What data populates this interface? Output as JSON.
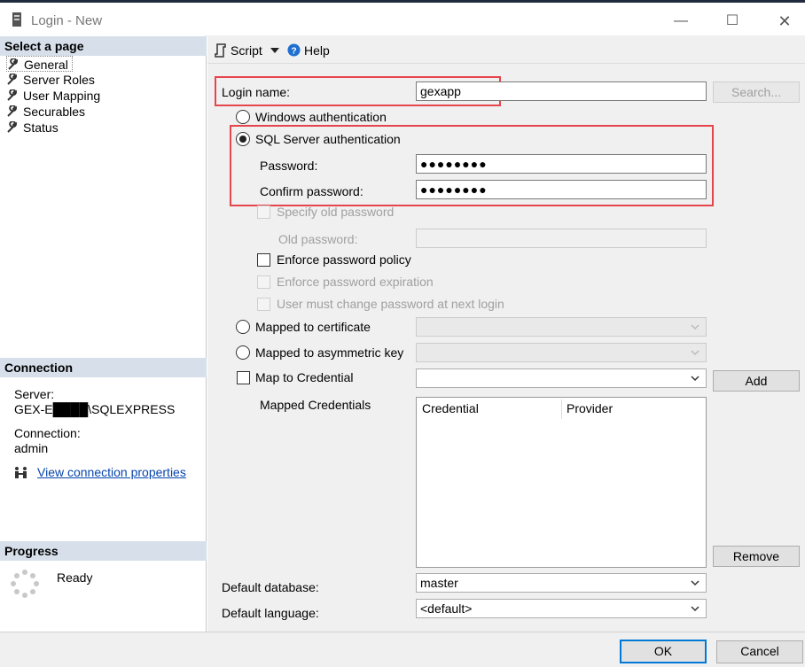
{
  "window": {
    "title": "Login - New"
  },
  "left": {
    "select_header": "Select a page",
    "pages": [
      "General",
      "Server Roles",
      "User Mapping",
      "Securables",
      "Status"
    ],
    "connection_header": "Connection",
    "server_label": "Server:",
    "server_value": "GEX-E████\\SQLEXPRESS",
    "connection_label": "Connection:",
    "connection_value": "admin",
    "view_props_link": "View connection properties",
    "progress_header": "Progress",
    "progress_status": "Ready"
  },
  "toolbar": {
    "script_label": "Script",
    "help_label": "Help"
  },
  "form": {
    "login_name_label": "Login name:",
    "login_name_value": "gexapp",
    "search_button": "Search...",
    "windows_auth": "Windows authentication",
    "sql_auth": "SQL Server authentication",
    "password_label": "Password:",
    "password_value": "●●●●●●●●",
    "confirm_label": "Confirm password:",
    "confirm_value": "●●●●●●●●",
    "specify_old": "Specify old password",
    "old_password_label": "Old password:",
    "enforce_policy": "Enforce password policy",
    "enforce_expiration": "Enforce password expiration",
    "must_change": "User must change password at next login",
    "mapped_cert": "Mapped to certificate",
    "mapped_asym": "Mapped to asymmetric key",
    "map_credential": "Map to Credential",
    "add_button": "Add",
    "mapped_credentials_label": "Mapped Credentials",
    "grid_columns": [
      "Credential",
      "Provider"
    ],
    "remove_button": "Remove",
    "default_db_label": "Default database:",
    "default_db_value": "master",
    "default_lang_label": "Default language:",
    "default_lang_value": "<default>"
  },
  "footer": {
    "ok_button": "OK",
    "cancel_button": "Cancel"
  },
  "colors": {
    "accent": "#0078d7",
    "highlight_border": "#e5454c",
    "section_header": "#d6dfea"
  }
}
